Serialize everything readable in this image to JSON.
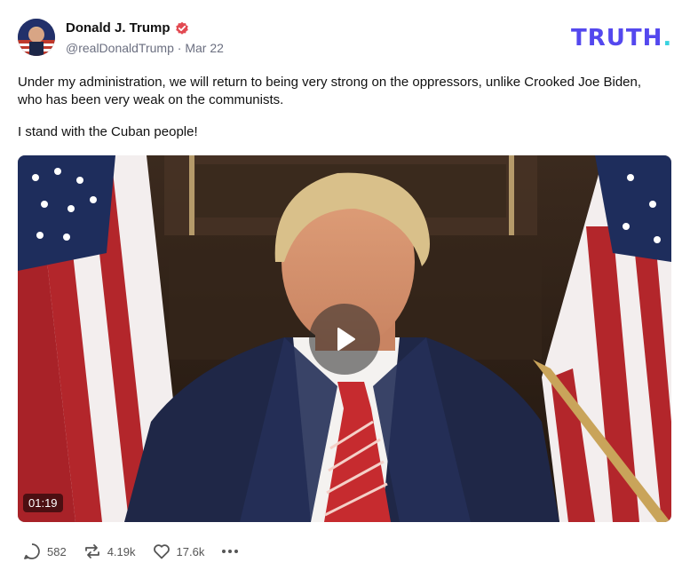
{
  "author": {
    "name": "Donald J. Trump",
    "handle": "@realDonaldTrump",
    "separator": "·",
    "date": "Mar 22"
  },
  "brand": {
    "logo_text": "TRUTH",
    "logo_dot": "."
  },
  "post": {
    "line1": "Under my administration, we will return to being very strong on the oppressors, unlike Crooked Joe Biden, who has been very weak on the communists.",
    "line2": "I stand with the Cuban people!"
  },
  "video": {
    "duration": "01:19"
  },
  "actions": {
    "replies": "582",
    "retruths": "4.19k",
    "likes": "17.6k"
  },
  "colors": {
    "brand": "#5448ee",
    "brand_dot": "#39d3e0",
    "verified": "#e24a52"
  },
  "icons": [
    "verified-badge-icon",
    "play-icon",
    "reply-icon",
    "retruth-icon",
    "like-icon",
    "more-icon"
  ]
}
